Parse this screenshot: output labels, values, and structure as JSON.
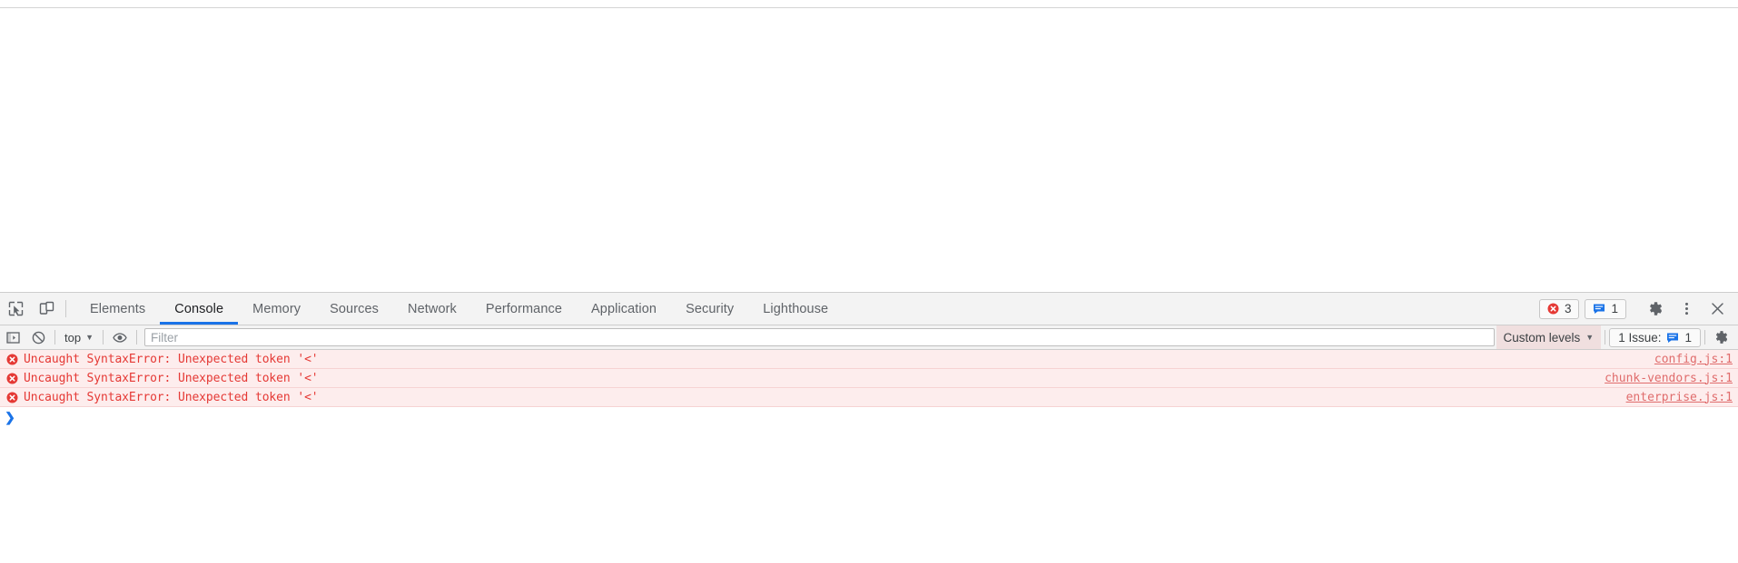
{
  "devtools": {
    "tabstrip": {
      "inspect_icon": "inspect-element-icon",
      "device_icon": "device-toolbar-icon",
      "tabs": [
        {
          "label": "Elements",
          "active": false
        },
        {
          "label": "Console",
          "active": true
        },
        {
          "label": "Memory",
          "active": false
        },
        {
          "label": "Sources",
          "active": false
        },
        {
          "label": "Network",
          "active": false
        },
        {
          "label": "Performance",
          "active": false
        },
        {
          "label": "Application",
          "active": false
        },
        {
          "label": "Security",
          "active": false
        },
        {
          "label": "Lighthouse",
          "active": false
        }
      ],
      "error_count": "3",
      "message_count": "1",
      "settings_icon": "gear-icon",
      "more_icon": "more-vertical-icon",
      "close_icon": "close-icon"
    },
    "console_toolbar": {
      "sidebar_icon": "console-sidebar-icon",
      "clear_icon": "clear-console-icon",
      "context": "top",
      "context_caret": "▼",
      "eye_icon": "live-expression-eye-icon",
      "filter_value": "",
      "filter_placeholder": "Filter",
      "levels_label": "Custom levels",
      "levels_caret": "▼",
      "issues_label": "1 Issue:",
      "issues_count": "1",
      "settings_icon": "console-settings-gear-icon"
    },
    "console_messages": [
      {
        "level": "error",
        "icon": "error-circle-icon",
        "text": "Uncaught SyntaxError: Unexpected token '<'",
        "source": "config.js:1"
      },
      {
        "level": "error",
        "icon": "error-circle-icon",
        "text": "Uncaught SyntaxError: Unexpected token '<'",
        "source": "chunk-vendors.js:1"
      },
      {
        "level": "error",
        "icon": "error-circle-icon",
        "text": "Uncaught SyntaxError: Unexpected token '<'",
        "source": "enterprise.js:1"
      }
    ],
    "prompt": {
      "chevron": "❯",
      "value": "",
      "placeholder": ""
    },
    "colors": {
      "accent": "#1a73e8",
      "error_text": "#e53935",
      "error_row_bg": "#fdeded",
      "toolbar_bg": "#f3f3f3",
      "levels_active_bg": "#f0dfdf"
    }
  }
}
